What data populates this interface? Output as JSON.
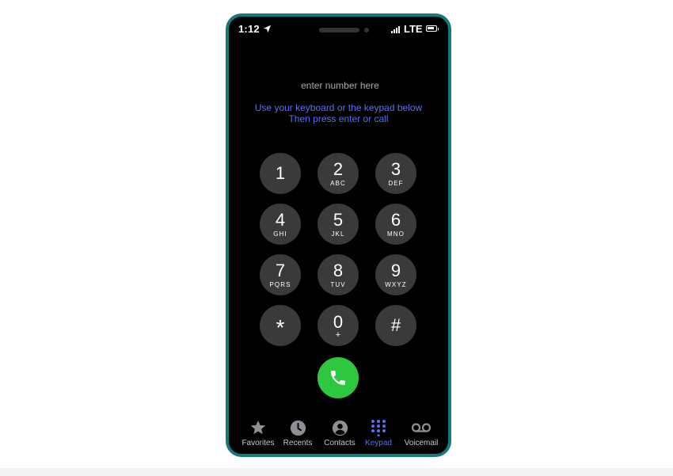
{
  "status_bar": {
    "time": "1:12",
    "network": "LTE"
  },
  "dialer": {
    "number_placeholder": "enter number here",
    "number_value": "",
    "instructions": [
      "Use your keyboard or the keypad below",
      "Then press enter or call"
    ]
  },
  "keypad": {
    "keys": [
      {
        "digit": "1",
        "letters": ""
      },
      {
        "digit": "2",
        "letters": "ABC"
      },
      {
        "digit": "3",
        "letters": "DEF"
      },
      {
        "digit": "4",
        "letters": "GHI"
      },
      {
        "digit": "5",
        "letters": "JKL"
      },
      {
        "digit": "6",
        "letters": "MNO"
      },
      {
        "digit": "7",
        "letters": "PQRS"
      },
      {
        "digit": "8",
        "letters": "TUV"
      },
      {
        "digit": "9",
        "letters": "WXYZ"
      },
      {
        "digit": "*",
        "letters": ""
      },
      {
        "digit": "0",
        "letters": "+"
      },
      {
        "digit": "#",
        "letters": ""
      }
    ]
  },
  "tab_bar": {
    "items": [
      {
        "label": "Favorites",
        "icon": "star-icon"
      },
      {
        "label": "Recents",
        "icon": "clock-icon"
      },
      {
        "label": "Contacts",
        "icon": "contact-icon"
      },
      {
        "label": "Keypad",
        "icon": "keypad-icon",
        "active": true
      },
      {
        "label": "Voicemail",
        "icon": "voicemail-icon"
      }
    ]
  },
  "colors": {
    "phone_border": "#137b7f",
    "accent": "#5a6ef4",
    "call_green": "#2ec840",
    "key_background": "#3a3a3c"
  }
}
